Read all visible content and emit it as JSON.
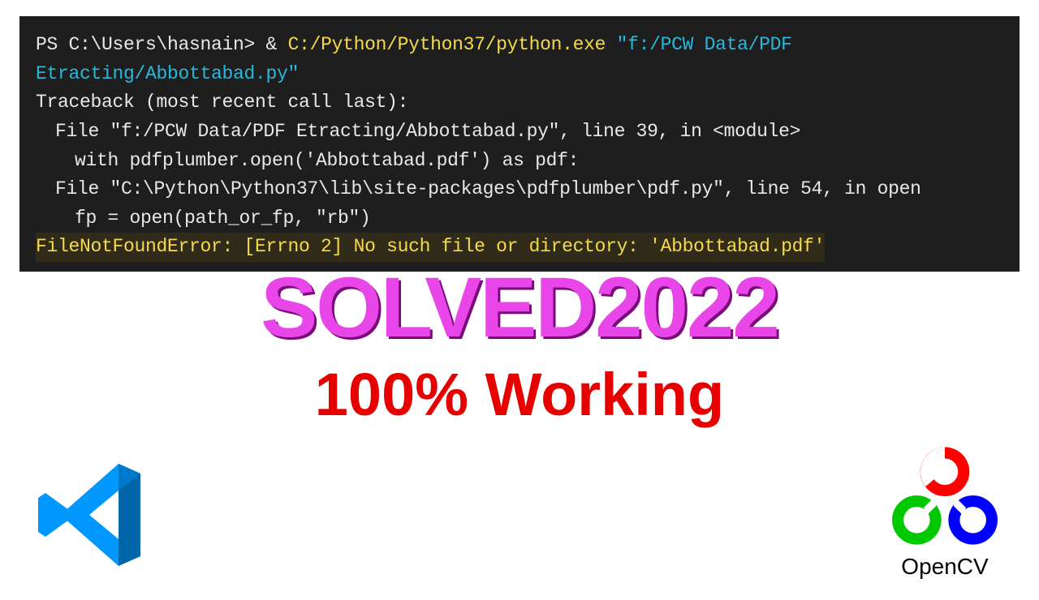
{
  "terminal": {
    "prompt": "PS C:\\Users\\hasnain> & ",
    "pythonPath": "C:/Python/Python37/python.exe",
    "scriptPath": " \"f:/PCW Data/PDF Etracting/Abbottabad.py\"",
    "tracebackHeader": "Traceback (most recent call last):",
    "file1": "File \"f:/PCW Data/PDF Etracting/Abbottabad.py\", line 39, in <module>",
    "code1": "with pdfplumber.open('Abbottabad.pdf') as pdf:",
    "file2": "File \"C:\\Python\\Python37\\lib\\site-packages\\pdfplumber\\pdf.py\", line 54, in open",
    "code2": "fp = open(path_or_fp, \"rb\")",
    "error": "FileNotFoundError: [Errno 2] No such file or directory: 'Abbottabad.pdf'"
  },
  "headlines": {
    "solved": "SOLVED2022",
    "working": "100% Working"
  },
  "logos": {
    "vscode": "vscode-icon",
    "opencvLabel": "OpenCV"
  }
}
